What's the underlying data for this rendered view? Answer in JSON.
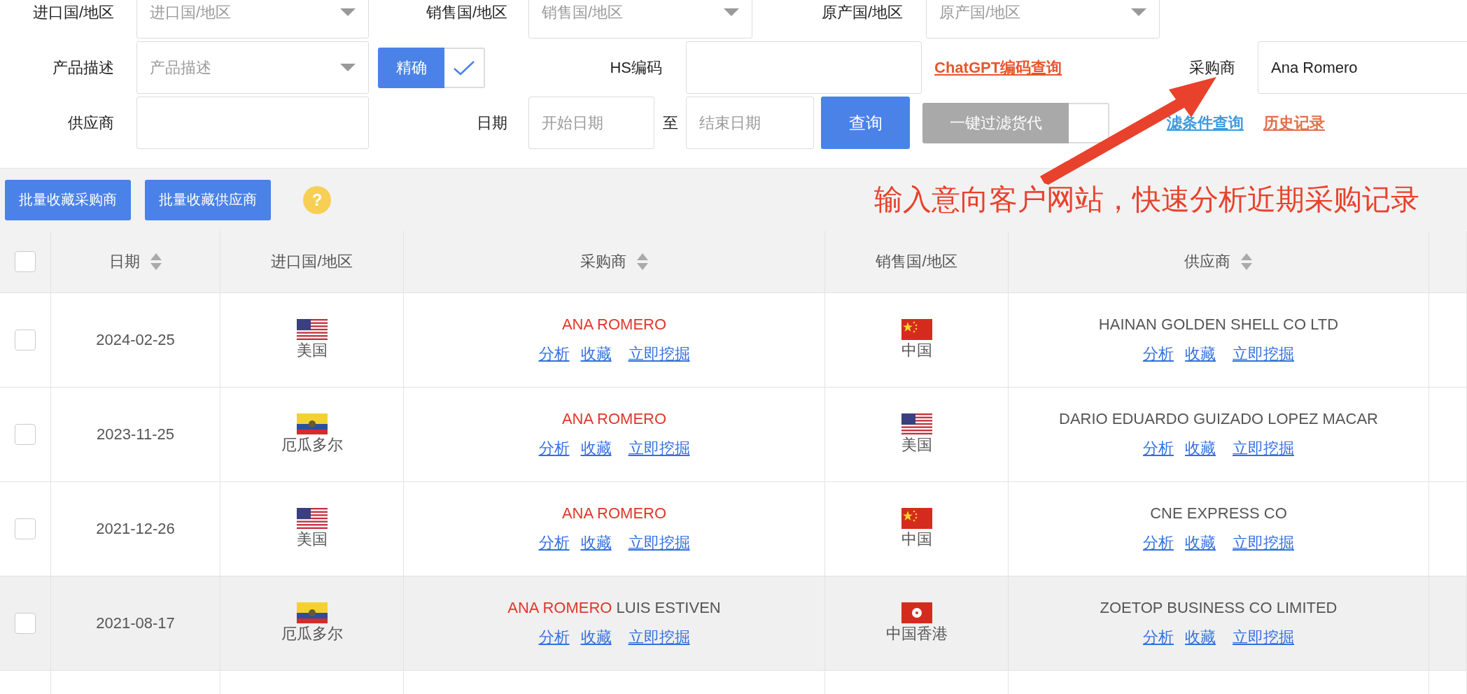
{
  "filters": {
    "items": [
      {
        "kind": "label",
        "text": "进口国/地区"
      },
      {
        "kind": "select",
        "placeholder": "进口国/地区"
      },
      {
        "kind": "label",
        "text": "销售国/地区"
      },
      {
        "kind": "select",
        "placeholder": "销售国/地区"
      },
      {
        "kind": "label",
        "text": "原产国/地区"
      },
      {
        "kind": "select",
        "placeholder": "原产国/地区"
      },
      {
        "kind": "label",
        "text": "产品描述"
      },
      {
        "kind": "select",
        "placeholder": "产品描述"
      },
      {
        "kind": "toggle",
        "text": "精确",
        "checked": true
      },
      {
        "kind": "label",
        "text": "HS编码"
      },
      {
        "kind": "input"
      },
      {
        "kind": "link",
        "text": "ChatGPT编码查询",
        "color": "#e8562a"
      },
      {
        "kind": "label",
        "text": "采购商"
      },
      {
        "kind": "input",
        "value": "Ana Romero"
      },
      {
        "kind": "label",
        "text": "供应商"
      },
      {
        "kind": "input"
      },
      {
        "kind": "label",
        "text": "日期"
      },
      {
        "kind": "input",
        "placeholder": "开始日期"
      },
      {
        "kind": "label",
        "text": "至"
      },
      {
        "kind": "input",
        "placeholder": "结束日期"
      },
      {
        "kind": "button",
        "text": "查询"
      },
      {
        "kind": "switch",
        "text": "一键过滤货代",
        "on": false
      },
      {
        "kind": "link",
        "text": "滤条件查询",
        "color": "#3b9be0"
      },
      {
        "kind": "link",
        "text": "历史记录",
        "color": "#e0704a"
      }
    ]
  },
  "actions": [
    {
      "label": "批量收藏采购商"
    },
    {
      "label": "批量收藏供应商"
    }
  ],
  "help": {
    "text": "?"
  },
  "annotation": {
    "text": "输入意向客户网站，快速分析近期采购记录"
  },
  "table": {
    "columns": [
      {
        "kind": "check",
        "checked": false
      },
      {
        "label": "日期",
        "sortable": true
      },
      {
        "label": "进口国/地区",
        "sortable": false
      },
      {
        "label": "采购商",
        "sortable": true
      },
      {
        "label": "销售国/地区",
        "sortable": false
      },
      {
        "label": "供应商",
        "sortable": true
      }
    ],
    "rows": [
      {
        "checked": false,
        "hovered": false,
        "date": "2024-02-25",
        "import": {
          "kind": "us",
          "name": "美国"
        },
        "buyer": {
          "match": "ANA ROMERO"
        },
        "sales": {
          "kind": "cn",
          "name": "中国"
        },
        "supplier": "HAINAN GOLDEN SHELL CO LTD",
        "links": [
          "分析",
          "收藏",
          "立即挖掘"
        ],
        "supplier_links": [
          "分析",
          "收藏",
          "立即挖掘"
        ]
      },
      {
        "checked": false,
        "hovered": false,
        "date": "2023-11-25",
        "import": {
          "kind": "ec",
          "name": "厄瓜多尔"
        },
        "buyer": {
          "match": "ANA ROMERO"
        },
        "sales": {
          "kind": "us",
          "name": "美国"
        },
        "supplier": "DARIO EDUARDO GUIZADO LOPEZ MACAR",
        "links": [
          "分析",
          "收藏",
          "立即挖掘"
        ],
        "supplier_links": [
          "分析",
          "收藏",
          "立即挖掘"
        ]
      },
      {
        "checked": false,
        "hovered": false,
        "date": "2021-12-26",
        "import": {
          "kind": "us",
          "name": "美国"
        },
        "buyer": {
          "match": "ANA ROMERO"
        },
        "sales": {
          "kind": "cn",
          "name": "中国"
        },
        "supplier": "CNE EXPRESS CO",
        "links": [
          "分析",
          "收藏",
          "立即挖掘"
        ],
        "supplier_links": [
          "分析",
          "收藏",
          "立即挖掘"
        ]
      },
      {
        "checked": false,
        "hovered": true,
        "date": "2021-08-17",
        "import": {
          "kind": "ec",
          "name": "厄瓜多尔"
        },
        "buyer": {
          "match": "ANA ROMERO",
          "rest": "LUIS ESTIVEN"
        },
        "sales": {
          "kind": "hk",
          "name": "中国香港"
        },
        "supplier": "ZOETOP BUSINESS CO LIMITED",
        "links": [
          "分析",
          "收藏",
          "立即挖掘"
        ],
        "supplier_links": [
          "分析",
          "收藏",
          "立即挖掘"
        ]
      }
    ]
  }
}
